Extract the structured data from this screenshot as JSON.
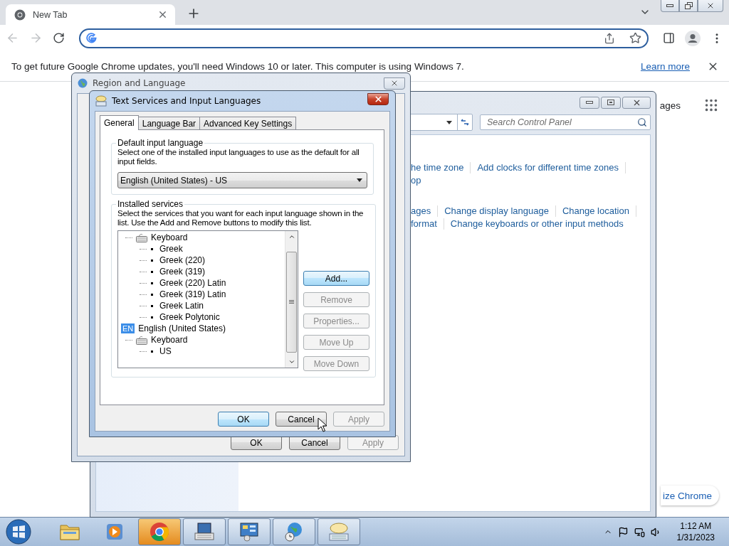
{
  "browser": {
    "tab": {
      "title": "New Tab"
    },
    "infobar": {
      "message": "To get future Google Chrome updates, you'll need Windows 10 or later. This computer is using Windows 7.",
      "link": "Learn more"
    },
    "page": {
      "apps_link": "ages",
      "customize_button": "ize Chrome"
    }
  },
  "control_panel": {
    "search": {
      "placeholder": "Search Control Panel"
    },
    "link_groups": [
      {
        "rows": [
          [
            "he time zone",
            "Add clocks for different time zones"
          ],
          [
            "op"
          ]
        ]
      },
      {
        "rows": [
          [
            "ages",
            "Change display language",
            "Change location"
          ],
          [
            "format",
            "Change keyboards or other input methods"
          ]
        ]
      }
    ]
  },
  "region_dialog": {
    "title": "Region and Language",
    "buttons": [
      {
        "label": "OK",
        "disabled": false,
        "highlighted": false
      },
      {
        "label": "Cancel",
        "disabled": false,
        "highlighted": false
      },
      {
        "label": "Apply",
        "disabled": true,
        "highlighted": false
      }
    ]
  },
  "text_services_dialog": {
    "title": "Text Services and Input Languages",
    "tabs": [
      {
        "label": "General",
        "selected": true
      },
      {
        "label": "Language Bar",
        "selected": false
      },
      {
        "label": "Advanced Key Settings",
        "selected": false
      }
    ],
    "default_language": {
      "legend": "Default input language",
      "description": "Select one of the installed input languages to use as the default for all input fields.",
      "dropdown": {
        "value": "English (United States) - US"
      }
    },
    "installed_services": {
      "legend": "Installed services",
      "description": "Select the services that you want for each input language shown in the list. Use the Add and Remove buttons to modify this list.",
      "tree": [
        {
          "kind": "category",
          "label": "Keyboard",
          "children": [
            {
              "kind": "service",
              "label": "Greek"
            },
            {
              "kind": "service",
              "label": "Greek (220)"
            },
            {
              "kind": "service",
              "label": "Greek (319)"
            },
            {
              "kind": "service",
              "label": "Greek (220) Latin"
            },
            {
              "kind": "service",
              "label": "Greek (319) Latin"
            },
            {
              "kind": "service",
              "label": "Greek Latin"
            },
            {
              "kind": "service",
              "label": "Greek Polytonic"
            }
          ]
        },
        {
          "kind": "language",
          "badge": "EN",
          "label": "English (United States)",
          "children": [
            {
              "kind": "category",
              "label": "Keyboard",
              "children": [
                {
                  "kind": "service",
                  "label": "US"
                }
              ]
            }
          ]
        }
      ],
      "buttons": [
        {
          "label": "Add...",
          "disabled": false,
          "highlighted": true
        },
        {
          "label": "Remove",
          "disabled": true,
          "highlighted": false
        },
        {
          "label": "Properties...",
          "disabled": true,
          "highlighted": false
        },
        {
          "label": "Move Up",
          "disabled": true,
          "highlighted": false
        },
        {
          "label": "Move Down",
          "disabled": true,
          "highlighted": false
        }
      ]
    },
    "buttons": [
      {
        "label": "OK",
        "disabled": false,
        "highlighted": true
      },
      {
        "label": "Cancel",
        "disabled": false,
        "highlighted": false
      },
      {
        "label": "Apply",
        "disabled": true,
        "highlighted": false
      }
    ]
  },
  "taskbar": {
    "apps": [
      {
        "kind": "folder",
        "running": false,
        "active": false
      },
      {
        "kind": "media",
        "running": false,
        "active": false
      },
      {
        "kind": "chrome",
        "running": true,
        "active": true
      },
      {
        "kind": "keyboard",
        "running": true,
        "active": false
      },
      {
        "kind": "control-panel",
        "running": true,
        "active": false
      },
      {
        "kind": "globe",
        "running": true,
        "active": false
      },
      {
        "kind": "speech",
        "running": true,
        "active": false
      }
    ],
    "clock": {
      "time": "1:12 AM",
      "date": "1/31/2023"
    }
  }
}
